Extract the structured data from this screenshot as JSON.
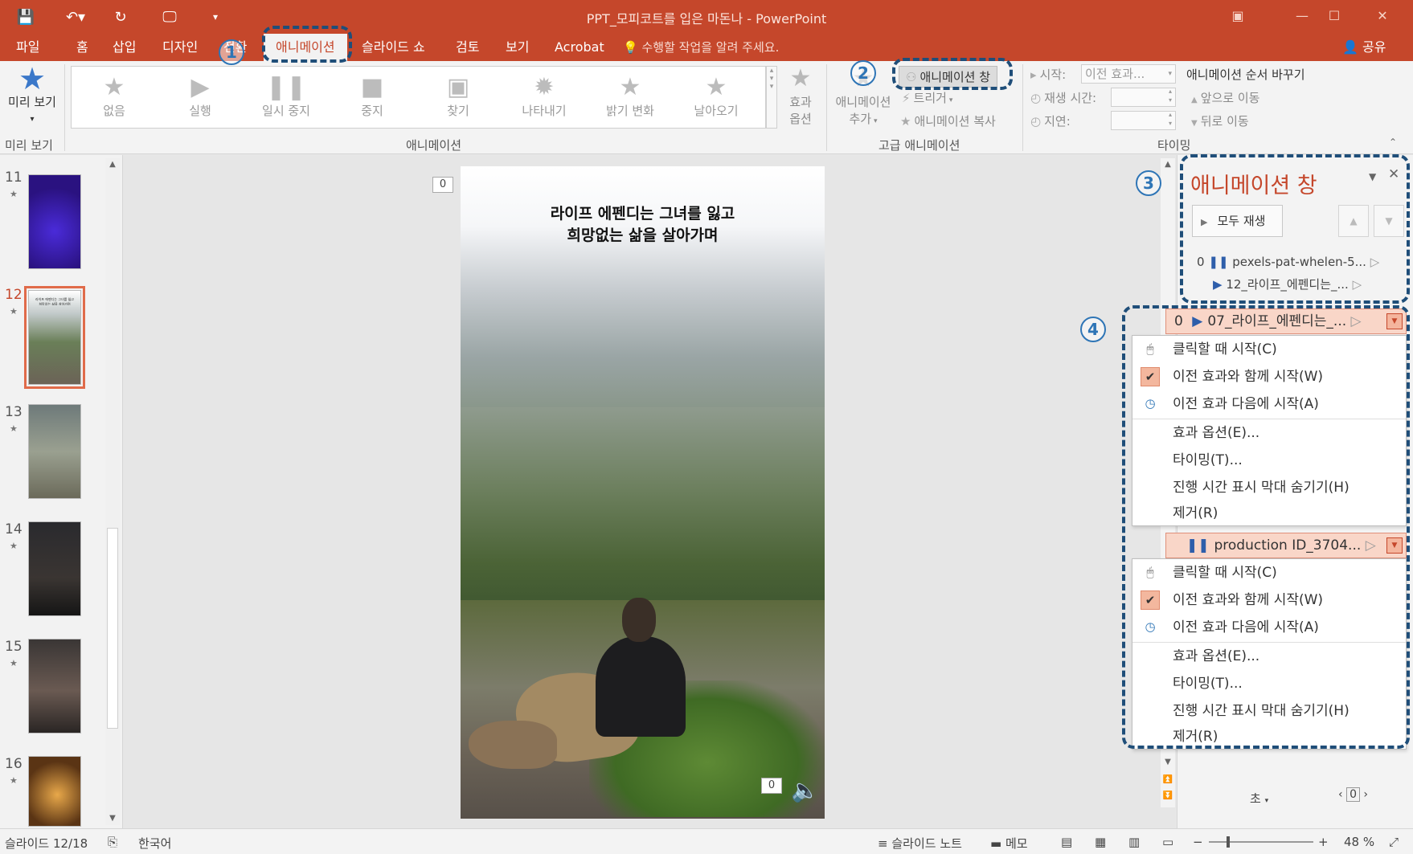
{
  "window": {
    "title": "PPT_모피코트를 입은 마돈나 - PowerPoint",
    "colors": {
      "accent": "#c5472b",
      "annotation": "#1f4e79"
    }
  },
  "qat": {
    "icons": [
      "save-icon",
      "undo-icon",
      "redo-icon",
      "slideshow-icon",
      "customize-icon"
    ]
  },
  "tabs": [
    {
      "label": "파일"
    },
    {
      "label": "홈"
    },
    {
      "label": "삽입"
    },
    {
      "label": "디자인"
    },
    {
      "label": "전환"
    },
    {
      "label": "애니메이션"
    },
    {
      "label": "슬라이드 쇼"
    },
    {
      "label": "검토"
    },
    {
      "label": "보기"
    },
    {
      "label": "Acrobat"
    }
  ],
  "tellme": "수행할 작업을 알려 주세요.",
  "share": "공유",
  "ribbon": {
    "preview": {
      "label": "미리 보기",
      "group": "미리 보기"
    },
    "gallery": {
      "items": [
        "없음",
        "실행",
        "일시 중지",
        "중지",
        "찾기",
        "나타내기",
        "밝기 변화",
        "날아오기"
      ],
      "group": "애니메이션"
    },
    "effect_options": {
      "line1": "효과",
      "line2": "옵션"
    },
    "advanced": {
      "add_line1": "애니메이션",
      "add_line2": "추가",
      "pane": "애니메이션 창",
      "trigger": "트리거",
      "copy": "애니메이션 복사",
      "group": "고급 애니메이션"
    },
    "timing": {
      "start_label": "시작:",
      "start_value": "이전 효과...",
      "duration_label": "재생 시간:",
      "delay_label": "지연:",
      "reorder_title": "애니메이션 순서 바꾸기",
      "move_earlier": "앞으로 이동",
      "move_later": "뒤로 이동",
      "group": "타이밍"
    }
  },
  "thumbnails": [
    {
      "num": "11",
      "text": ""
    },
    {
      "num": "12",
      "text": "라이프 에펜디는 그녀를 잃고 희망없는 삶을 살아가며"
    },
    {
      "num": "13",
      "text": ""
    },
    {
      "num": "14",
      "text": ""
    },
    {
      "num": "15",
      "text": ""
    },
    {
      "num": "16",
      "text": ""
    }
  ],
  "slide": {
    "caption_line1": "라이프 에펜디는 그녀를 잃고",
    "caption_line2": "희망없는 삶을 살아가며",
    "tag_top": "0",
    "tag_bottom": "0"
  },
  "anim_pane": {
    "title": "애니메이션 창",
    "play_all": "모두 재생",
    "rows": [
      {
        "order": "0",
        "name": "pexels-pat-whelen-5..."
      },
      {
        "order": "",
        "name": "12_라이프_에펜디는_..."
      }
    ],
    "dropdown1": {
      "order": "0",
      "name": "07_라이프_에펜디는_...",
      "items": [
        "클릭할 때 시작(C)",
        "이전 효과와 함께 시작(W)",
        "이전 효과 다음에 시작(A)",
        "효과 옵션(E)...",
        "타이밍(T)...",
        "진행 시간 표시 막대 숨기기(H)",
        "제거(R)"
      ]
    },
    "dropdown2": {
      "name": "production ID_3704...",
      "items": [
        "클릭할 때 시작(C)",
        "이전 효과와 함께 시작(W)",
        "이전 효과 다음에 시작(A)",
        "효과 옵션(E)...",
        "타이밍(T)...",
        "진행 시간 표시 막대 숨기기(H)",
        "제거(R)"
      ]
    },
    "footer_seconds": "초",
    "footer_zoom": "0"
  },
  "annotations": [
    "1",
    "2",
    "3",
    "4"
  ],
  "status": {
    "slide": "슬라이드 12/18",
    "language": "한국어",
    "notes": "슬라이드 노트",
    "comments": "메모",
    "zoom": "48 %"
  }
}
